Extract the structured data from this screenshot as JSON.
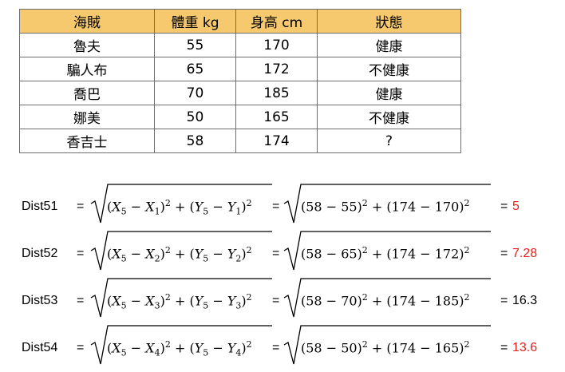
{
  "table": {
    "headers": [
      "海賊",
      "體重 kg",
      "身高 cm",
      "狀態"
    ],
    "rows": [
      [
        "魯夫",
        "55",
        "170",
        "健康"
      ],
      [
        "騙人布",
        "65",
        "172",
        "不健康"
      ],
      [
        "喬巴",
        "70",
        "185",
        "健康"
      ],
      [
        "娜美",
        "50",
        "165",
        "不健康"
      ],
      [
        "香吉士",
        "58",
        "174",
        "?"
      ]
    ]
  },
  "distances": [
    {
      "label": "Dist51",
      "eq1": "=",
      "eq2": "=",
      "eq3": "=",
      "i": "1",
      "a": "58",
      "b": "55",
      "c": "174",
      "d": "170",
      "result": "5",
      "result_color": "#e8201c"
    },
    {
      "label": "Dist52",
      "eq1": "=",
      "eq2": "=",
      "eq3": "=",
      "i": "2",
      "a": "58",
      "b": "65",
      "c": "174",
      "d": "172",
      "result": "7.28",
      "result_color": "#e8201c"
    },
    {
      "label": "Dist53",
      "eq1": "=",
      "eq2": "=",
      "eq3": "=",
      "i": "3",
      "a": "58",
      "b": "70",
      "c": "174",
      "d": "185",
      "result": "16.3",
      "result_color": "#000000"
    },
    {
      "label": "Dist54",
      "eq1": "=",
      "eq2": "=",
      "eq3": "=",
      "i": "4",
      "a": "58",
      "b": "50",
      "c": "174",
      "d": "165",
      "result": "13.6",
      "result_color": "#e8201c"
    }
  ],
  "colors": {
    "header_bg": "#f7c96e",
    "highlight": "#e8201c"
  }
}
